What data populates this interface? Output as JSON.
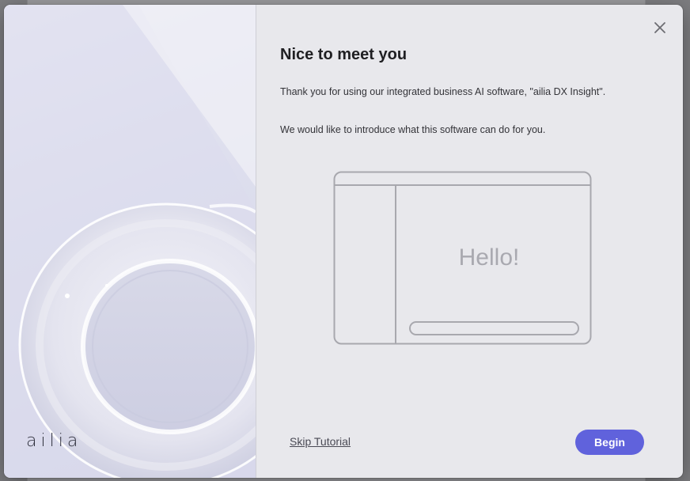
{
  "dialog": {
    "title": "Nice to meet you",
    "intro_line_1": "Thank you for using our integrated business AI software, \"ailia DX Insight\".",
    "intro_line_2": "We would like to introduce what this software can do for you.",
    "illustration_text": "Hello!",
    "skip_label": "Skip Tutorial",
    "begin_label": "Begin",
    "close_icon": "close-icon"
  },
  "brand": {
    "logo_text": "ailia",
    "accent_color": "#6062dc"
  }
}
